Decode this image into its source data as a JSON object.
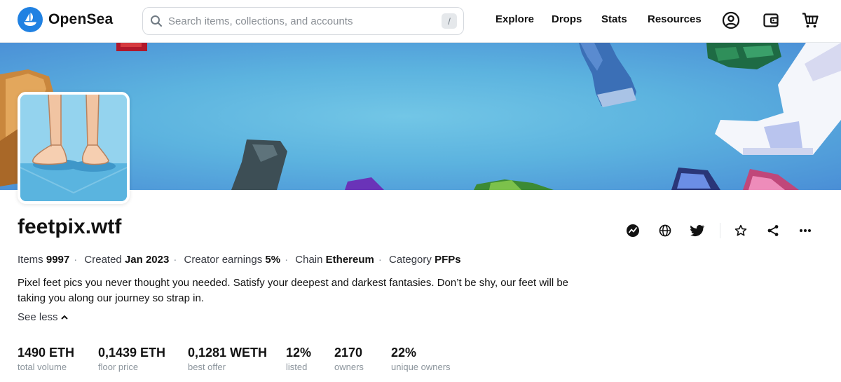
{
  "header": {
    "brand": "OpenSea",
    "search_placeholder": "Search items, collections, and accounts",
    "search_shortcut": "/",
    "nav": [
      "Explore",
      "Drops",
      "Stats",
      "Resources"
    ],
    "icons": [
      "account-icon",
      "wallet-icon",
      "cart-icon"
    ]
  },
  "collection": {
    "name": "feetpix.wtf",
    "meta": [
      {
        "label": "Items",
        "value": "9997"
      },
      {
        "label": "Created",
        "value": "Jan 2023"
      },
      {
        "label": "Creator earnings",
        "value": "5%"
      },
      {
        "label": "Chain",
        "value": "Ethereum"
      },
      {
        "label": "Category",
        "value": "PFPs"
      }
    ],
    "description": "Pixel feet pics you never thought you needed. Satisfy your deepest and darkest fantasies. Don’t be shy, our feet will be taking you along our journey so strap in.",
    "see_less": "See less",
    "actions": [
      "activity-icon",
      "globe-icon",
      "twitter-icon",
      "star-icon",
      "share-icon",
      "more-icon"
    ],
    "stats": [
      {
        "value": "1490 ETH",
        "label": "total volume"
      },
      {
        "value": "0,1439 ETH",
        "label": "floor price"
      },
      {
        "value": "0,1281 WETH",
        "label": "best offer"
      },
      {
        "value": "12%",
        "label": "listed"
      },
      {
        "value": "2170",
        "label": "owners"
      },
      {
        "value": "22%",
        "label": "unique owners"
      }
    ]
  },
  "colors": {
    "brand": "#2081e2",
    "text": "#121212",
    "muted": "#8a939b",
    "banner": "#5cb3df"
  }
}
